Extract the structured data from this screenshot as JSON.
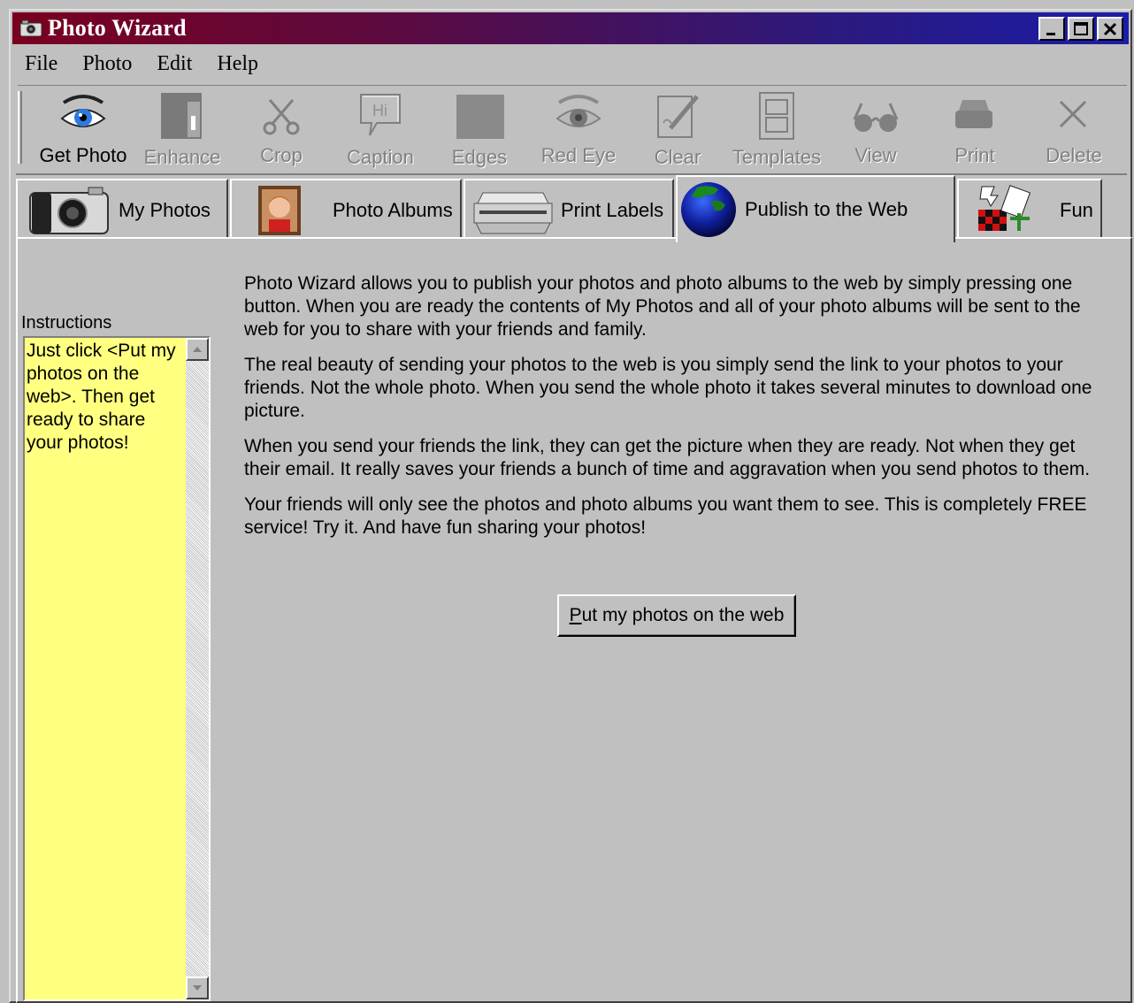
{
  "window": {
    "title": "Photo Wizard"
  },
  "menu": [
    "File",
    "Photo",
    "Edit",
    "Help"
  ],
  "toolbar": [
    {
      "label": "Get Photo",
      "icon": "eye-icon",
      "enabled": true
    },
    {
      "label": "Enhance",
      "icon": "enhance-icon",
      "enabled": false
    },
    {
      "label": "Crop",
      "icon": "scissors-icon",
      "enabled": false
    },
    {
      "label": "Caption",
      "icon": "speech-bubble-icon",
      "enabled": false
    },
    {
      "label": "Edges",
      "icon": "edges-icon",
      "enabled": false
    },
    {
      "label": "Red Eye",
      "icon": "red-eye-icon",
      "enabled": false
    },
    {
      "label": "Clear",
      "icon": "clear-icon",
      "enabled": false
    },
    {
      "label": "Templates",
      "icon": "templates-icon",
      "enabled": false
    },
    {
      "label": "View",
      "icon": "glasses-icon",
      "enabled": false
    },
    {
      "label": "Print",
      "icon": "printer-icon",
      "enabled": false
    },
    {
      "label": "Delete",
      "icon": "delete-icon",
      "enabled": false
    }
  ],
  "tabs": [
    {
      "label": "My Photos",
      "icon": "camera-icon"
    },
    {
      "label": "Photo Albums",
      "icon": "portrait-icon"
    },
    {
      "label": "Print Labels",
      "icon": "inkjet-printer-icon"
    },
    {
      "label": "Publish to the Web",
      "icon": "globe-icon",
      "active": true
    },
    {
      "label": "Fun",
      "icon": "checkerboard-fun-icon"
    }
  ],
  "instructions": {
    "label": "Instructions",
    "text": "Just click <Put my photos on the web>.  Then get ready to share your photos!"
  },
  "content": {
    "paragraphs": [
      "Photo Wizard allows you to publish your photos and photo albums to the web by simply pressing one button.  When you are ready the contents of My Photos and all of your photo albums will be sent to the web for you to share with your friends and family.",
      "The real beauty of sending your photos to the web is you simply send the link to your photos to your friends.  Not the whole photo.  When you send the whole photo it takes several minutes to download one picture.",
      "When you send your friends the link, they can get the picture when they are ready.  Not when they get their email.  It really saves your friends a bunch of time and aggravation when you send photos to them.",
      "Your friends will only see the photos and photo albums you want them to see.  This is completely FREE service!  Try it.  And have fun sharing your photos!"
    ],
    "button_label": "Put my photos on the web"
  },
  "colors": {
    "title_gradient_start": "#7a0020",
    "title_gradient_end": "#1c1ca8",
    "instructions_bg": "#ffff80",
    "face": "#c0c0c0"
  }
}
